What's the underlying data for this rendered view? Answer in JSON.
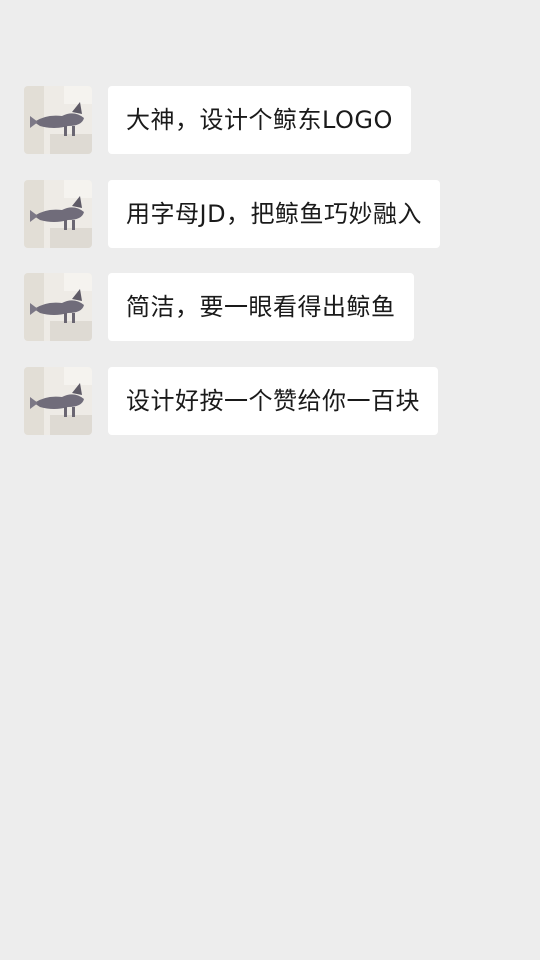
{
  "colors": {
    "background": "#ededed",
    "bubble": "#ffffff",
    "text": "#1a1a1a"
  },
  "messages": [
    {
      "avatar": "whale-avatar-icon",
      "text": "大神，设计个鲸东LOGO"
    },
    {
      "avatar": "whale-avatar-icon",
      "text": "用字母JD，把鲸鱼巧妙融入"
    },
    {
      "avatar": "whale-avatar-icon",
      "text": "简洁，要一眼看得出鲸鱼"
    },
    {
      "avatar": "whale-avatar-icon",
      "text": "设计好按一个赞给你一百块"
    }
  ]
}
